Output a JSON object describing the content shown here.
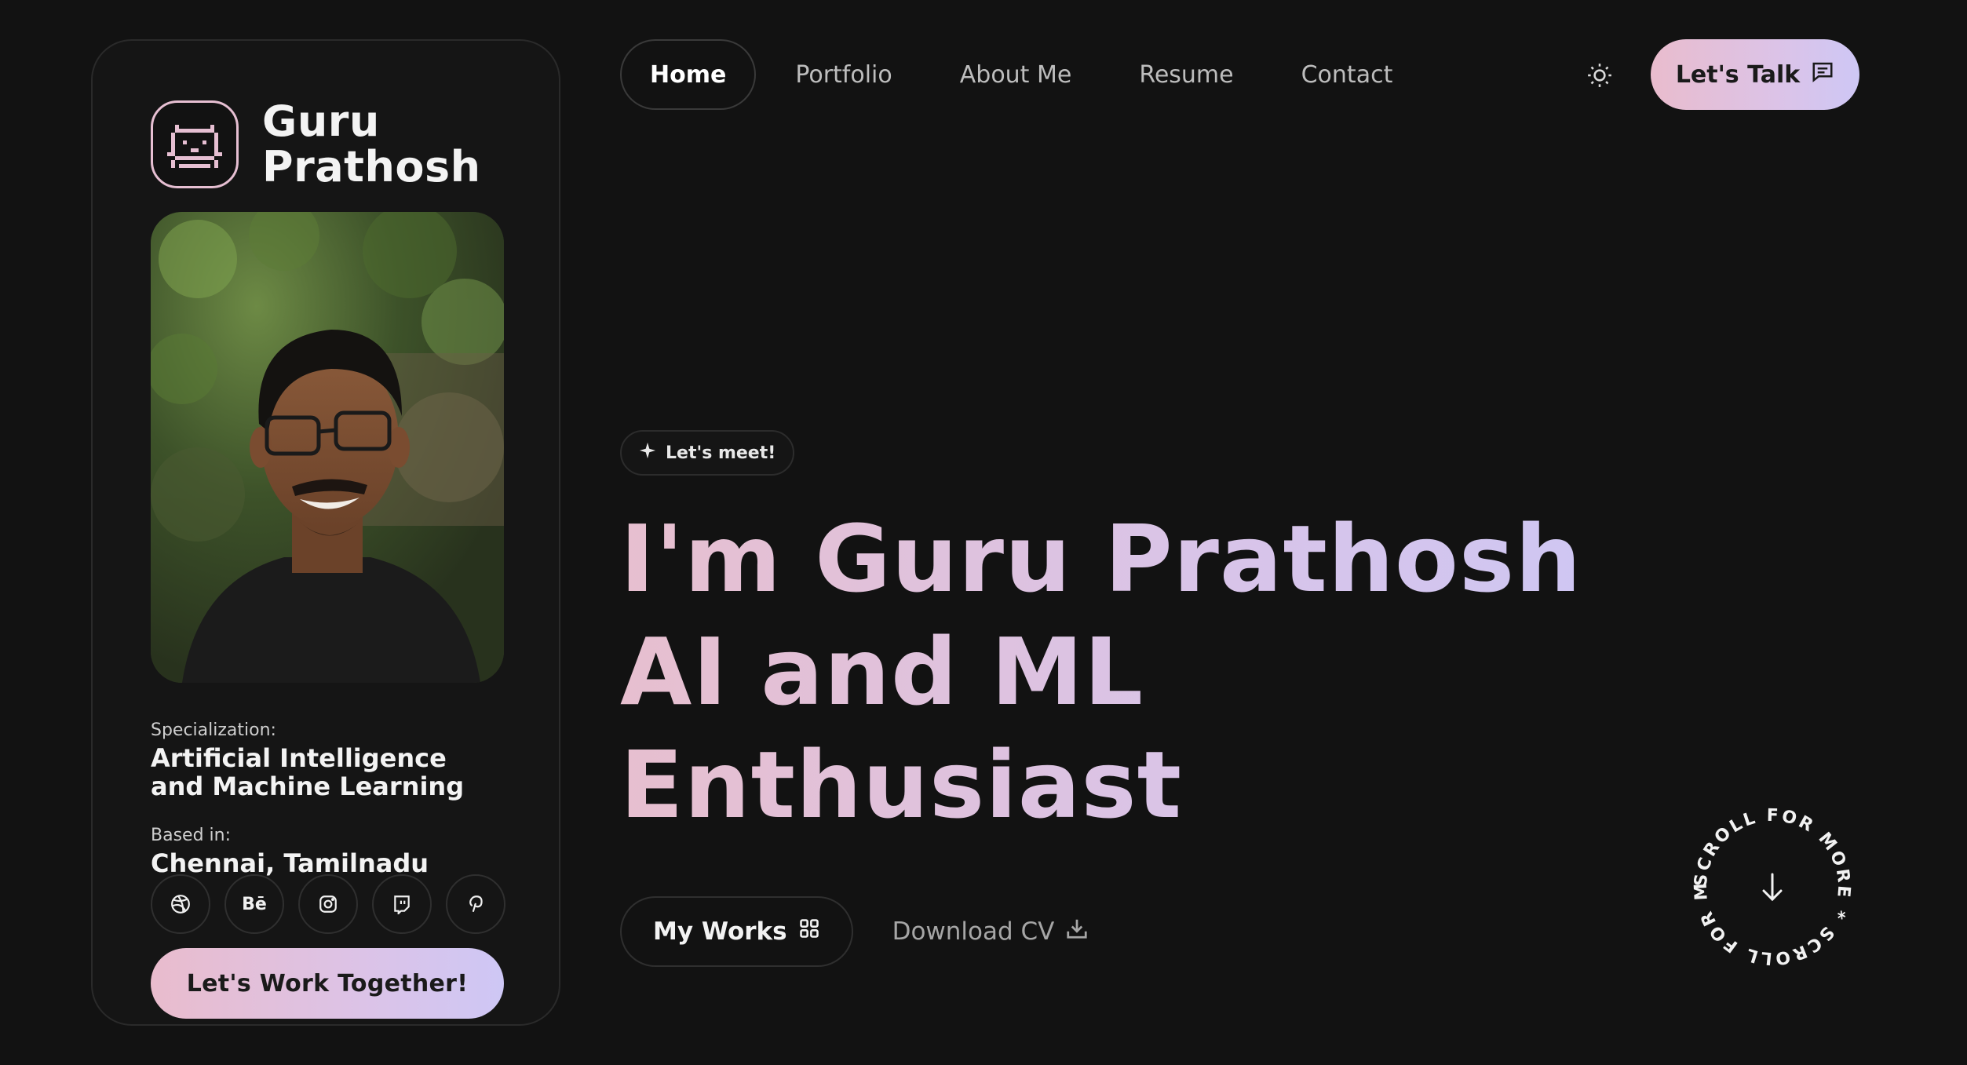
{
  "brand": {
    "name_line1": "Guru",
    "name_line2": "Prathosh",
    "logo_icon": "pixel-cat-icon"
  },
  "profile": {
    "photo_alt": "portrait-photo",
    "specialization_label": "Specialization:",
    "specialization_line1": "Artificial Intelligence",
    "specialization_line2": "and Machine Learning",
    "based_label": "Based in:",
    "based_value": "Chennai, Tamilnadu",
    "socials": [
      {
        "icon": "dribbble-icon"
      },
      {
        "icon": "behance-icon",
        "glyph": "Bē"
      },
      {
        "icon": "instagram-icon"
      },
      {
        "icon": "twitch-icon"
      },
      {
        "icon": "pinterest-icon"
      }
    ],
    "cta": "Let's Work Together!"
  },
  "nav": {
    "items": [
      {
        "label": "Home",
        "active": true
      },
      {
        "label": "Portfolio"
      },
      {
        "label": "About Me"
      },
      {
        "label": "Resume"
      },
      {
        "label": "Contact"
      }
    ],
    "theme_icon": "sun-icon",
    "talk_label": "Let's Talk",
    "talk_icon": "message-icon"
  },
  "hero": {
    "chip": "Let's meet!",
    "chip_icon": "sparkle-icon",
    "line1": "I'm Guru Prathosh",
    "line2": "AI and ML",
    "line3": "Enthusiast"
  },
  "actions": {
    "works_label": "My Works",
    "works_icon": "grid-icon",
    "cv_label": "Download CV",
    "cv_icon": "download-icon"
  },
  "scroll_badge": {
    "text": "SCROLL FOR MORE * SCROLL FOR MORE * ",
    "icon": "arrow-down-icon"
  },
  "colors": {
    "accent_start": "#e9bccd",
    "accent_end": "#cec7f5",
    "background": "#121212"
  }
}
